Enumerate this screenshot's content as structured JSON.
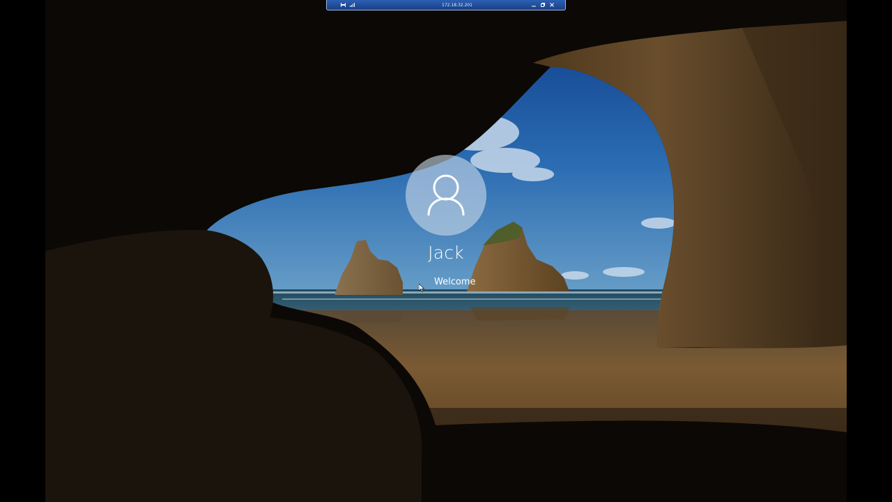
{
  "remote_session": {
    "host_address": "172.18.32.201",
    "pin_icon": "pin-icon",
    "signal_icon": "signal-bars-icon",
    "minimize_icon": "minimize-icon",
    "restore_icon": "restore-icon",
    "close_icon": "close-icon"
  },
  "lock_screen": {
    "background": "cave-beach-wallpaper",
    "avatar_icon": "user-avatar-icon",
    "user_name": "Jack",
    "status_text": "Welcome"
  },
  "colors": {
    "bar_blue": "#1f4a9a",
    "text": "#ffffff",
    "avatar_bg": "#c8d7e6"
  }
}
